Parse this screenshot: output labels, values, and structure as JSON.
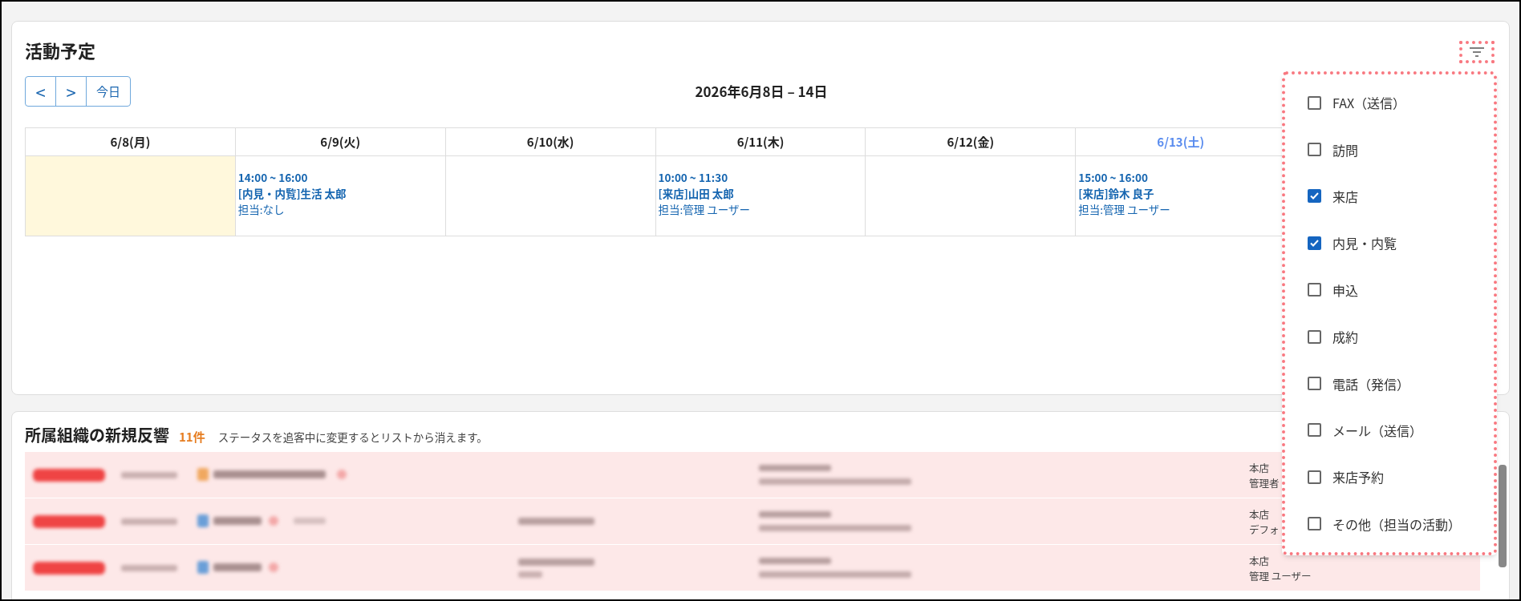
{
  "schedule": {
    "title": "活動予定",
    "nav": {
      "prev": "<",
      "next": ">",
      "today": "今日"
    },
    "range": "2026年6月8日 – 14日",
    "days": [
      {
        "label": "6/8(月)",
        "kind": "weekday",
        "today": true
      },
      {
        "label": "6/9(火)",
        "kind": "weekday",
        "today": false,
        "events": [
          {
            "time": "14:00 ~ 16:00",
            "title": "[内見・内覧]生活 太郎",
            "assignee": "担当:なし"
          }
        ]
      },
      {
        "label": "6/10(水)",
        "kind": "weekday",
        "today": false
      },
      {
        "label": "6/11(木)",
        "kind": "weekday",
        "today": false,
        "events": [
          {
            "time": "10:00 ~ 11:30",
            "title": "[来店]山田 太郎",
            "assignee": "担当:管理 ユーザー"
          }
        ]
      },
      {
        "label": "6/12(金)",
        "kind": "weekday",
        "today": false
      },
      {
        "label": "6/13(土)",
        "kind": "saturday",
        "today": false,
        "events": [
          {
            "time": "15:00 ~ 16:00",
            "title": "[来店]鈴木 良子",
            "assignee": "担当:管理 ユーザー"
          }
        ]
      }
    ]
  },
  "filter_menu": {
    "items": [
      {
        "label": "FAX（送信）",
        "checked": false
      },
      {
        "label": "訪問",
        "checked": false
      },
      {
        "label": "来店",
        "checked": true
      },
      {
        "label": "内見・内覧",
        "checked": true
      },
      {
        "label": "申込",
        "checked": false
      },
      {
        "label": "成約",
        "checked": false
      },
      {
        "label": "電話（発信）",
        "checked": false
      },
      {
        "label": "メール（送信）",
        "checked": false
      },
      {
        "label": "来店予約",
        "checked": false
      },
      {
        "label": "その他（担当の活動）",
        "checked": false
      }
    ]
  },
  "responses": {
    "title": "所属組織の新規反響",
    "count": "11件",
    "note": "ステータスを追客中に変更するとリストから消えます。",
    "rows": [
      {
        "branch": "本店",
        "staff": "管理者"
      },
      {
        "branch": "本店",
        "staff": "デフォ"
      },
      {
        "branch": "本店",
        "staff": "管理 ユーザー"
      }
    ]
  }
}
